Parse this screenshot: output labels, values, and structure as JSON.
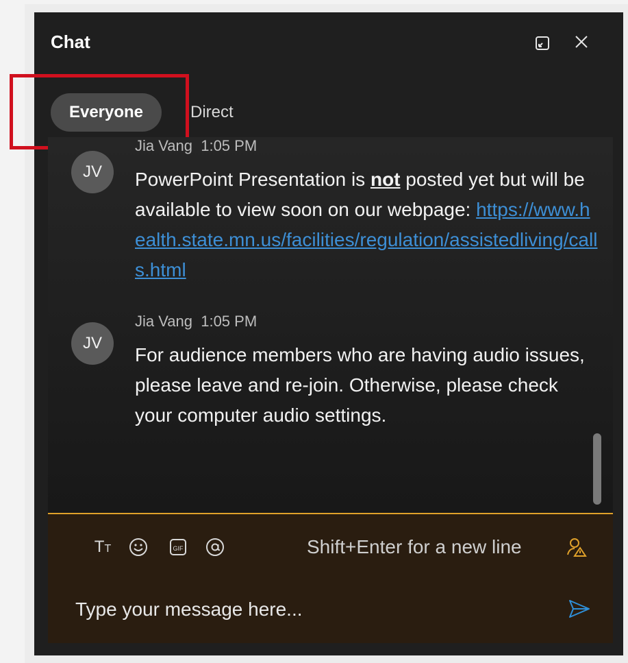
{
  "header": {
    "title": "Chat"
  },
  "tabs": [
    {
      "label": "Everyone",
      "active": true
    },
    {
      "label": "Direct",
      "active": false
    }
  ],
  "messages": [
    {
      "initials": "JV",
      "author": "Jia Vang",
      "time": "1:05 PM",
      "text_before": "PowerPoint Presentation is ",
      "emphasis": "not",
      "text_after": " posted yet but will be available to view soon on our webpage: ",
      "link": "https://www.health.state.mn.us/facilities/regulation/assistedliving/calls.html"
    },
    {
      "initials": "JV",
      "author": "Jia Vang",
      "time": "1:05 PM",
      "text": "For audience members who are having audio issues, please leave and re-join. Otherwise, please check your computer audio settings."
    }
  ],
  "compose": {
    "hint": "Shift+Enter for a new line",
    "placeholder": "Type your message here...",
    "tools": [
      "text-format-icon",
      "emoji-icon",
      "gif-icon",
      "mention-icon"
    ],
    "accent": "#e0a12a"
  },
  "colors": {
    "panel": "#1f1f1f",
    "link": "#3d8fd6",
    "highlight": "#d0101e"
  }
}
